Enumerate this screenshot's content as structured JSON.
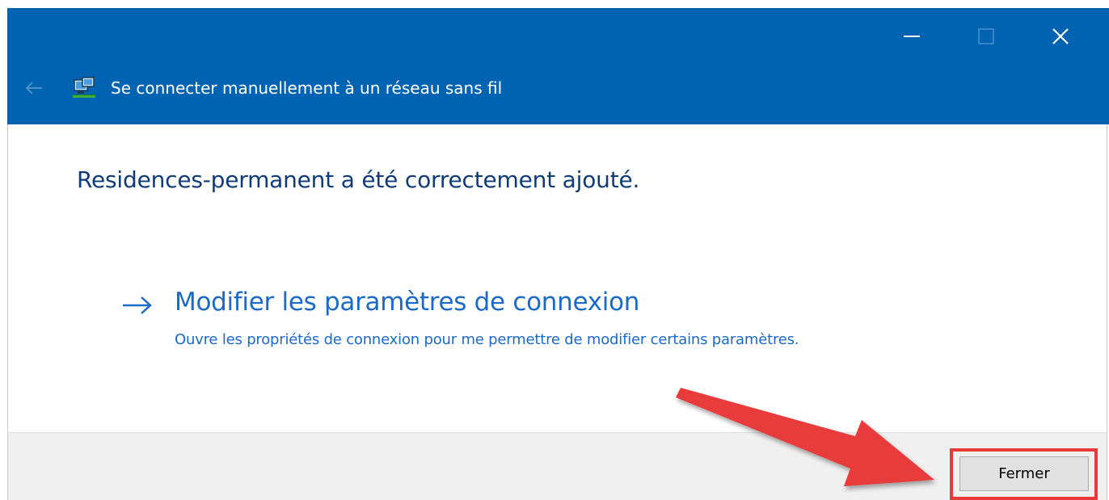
{
  "window": {
    "title": "Se connecter manuellement à un réseau sans fil",
    "titlebar_color": "#0063b1",
    "controls": {
      "minimize_icon": "minimize-icon",
      "maximize_icon": "maximize-icon",
      "close_icon": "close-icon"
    },
    "back_icon": "back-arrow-icon",
    "app_icon": "network-icon"
  },
  "content": {
    "heading": "Residences-permanent a été correctement ajouté.",
    "option": {
      "icon": "right-arrow-icon",
      "title": "Modifier les paramètres de connexion",
      "description": "Ouvre les propriétés de connexion pour me permettre de modifier certains paramètres.",
      "link_color": "#1b6ac9"
    }
  },
  "footer": {
    "close_label": "Fermer"
  },
  "annotation": {
    "color": "#e83a3a",
    "arrow_icon": "annotation-arrow-icon"
  }
}
